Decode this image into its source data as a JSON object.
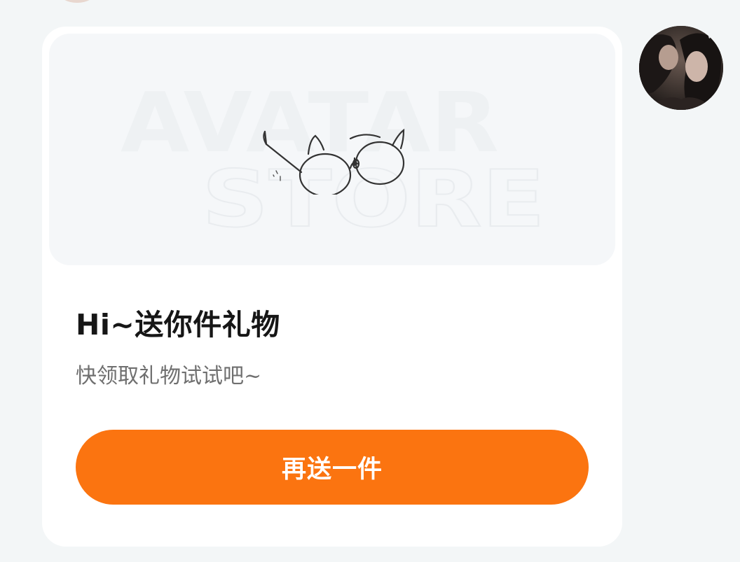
{
  "gift_card": {
    "banner_watermark_line1": "AVATAR",
    "banner_watermark_line2": "STORE",
    "item_icon": "cat-ear-glasses-icon",
    "title": "Hi~送你件礼物",
    "subtitle": "快领取礼物试试吧~",
    "send_again_label": "再送一件"
  },
  "user": {
    "avatar_icon": "user-avatar-photo"
  },
  "colors": {
    "accent": "#fb7410",
    "page_bg": "#f3f6f7",
    "card_bg": "#ffffff",
    "banner_bg": "#f5f7f9",
    "title": "#161616",
    "subtitle": "#6f6f6f"
  }
}
